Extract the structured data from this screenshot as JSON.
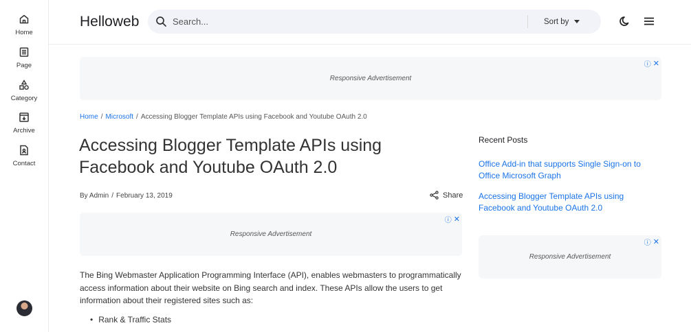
{
  "nav": {
    "items": [
      {
        "label": "Home",
        "icon": "home-icon"
      },
      {
        "label": "Page",
        "icon": "page-icon"
      },
      {
        "label": "Category",
        "icon": "category-icon"
      },
      {
        "label": "Archive",
        "icon": "archive-icon"
      },
      {
        "label": "Contact",
        "icon": "contact-icon"
      }
    ]
  },
  "header": {
    "brand": "Helloweb",
    "search_placeholder": "Search...",
    "sort_label": "Sort by"
  },
  "ads": {
    "label": "Responsive Advertisement"
  },
  "breadcrumb": {
    "home": "Home",
    "category": "Microsoft",
    "current": "Accessing Blogger Template APIs using Facebook and Youtube OAuth 2.0",
    "separator": "/"
  },
  "post": {
    "title": "Accessing Blogger Template APIs using Facebook and Youtube OAuth 2.0",
    "author": "By Admin",
    "date": "February 13, 2019",
    "share_label": "Share",
    "body": "The Bing Webmaster Application Programming Interface (API), enables webmasters to programmatically access information about their website on Bing search and index. These APIs allow the users to get information about their registered sites such as:",
    "list": [
      "Rank & Traffic Stats"
    ]
  },
  "sidebar": {
    "recent_title": "Recent Posts",
    "posts": [
      "Office Add-in that supports Single Sign-on to Office Microsoft Graph",
      "Accessing Blogger Template APIs using Facebook and Youtube OAuth 2.0"
    ]
  },
  "colors": {
    "link": "#1a73e8",
    "search_bg": "#f1f3f8",
    "ad_bg": "#f6f7f9"
  }
}
